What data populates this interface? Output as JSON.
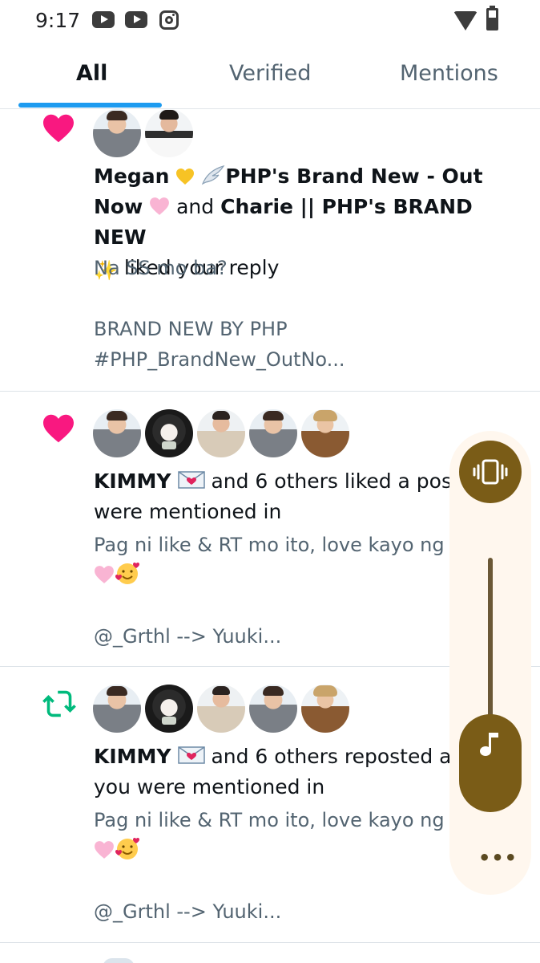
{
  "status_bar": {
    "time": "9:17",
    "notification_icons": [
      "youtube-icon",
      "youtube-icon",
      "instagram-icon"
    ],
    "system_icons": [
      "wifi-icon",
      "battery-icon"
    ]
  },
  "tabs": [
    {
      "label": "All",
      "active": true
    },
    {
      "label": "Verified",
      "active": false
    },
    {
      "label": "Mentions",
      "active": false
    }
  ],
  "colors": {
    "accent": "#1d9bf0",
    "like": "#f91880",
    "repost": "#00ba7c",
    "volume_panel": "#7a5c17"
  },
  "notifications": [
    {
      "type": "like",
      "icon": "heart-icon",
      "avatars": 2,
      "actor1_name": "Megan",
      "actor1_suffix": "PHP's Brand New - Out",
      "actor1_suffix2": "Now",
      "connector": "and",
      "actor2_name": "Charie || PHP's BRAND NEW",
      "action": "liked your reply",
      "quote_lines": [
        "Na SS mo ba?",
        "",
        "BRAND NEW BY PHP",
        "#PHP_BrandNew_OutNo..."
      ]
    },
    {
      "type": "like",
      "icon": "heart-icon",
      "avatars": 5,
      "actor_name": "KIMMY",
      "action_line1": "and 6 others liked a post you",
      "action_line2": "were mentioned in",
      "quote_line1": "Pag ni like & RT mo ito, love kayo ng PHP",
      "quote_line3": "@_Grthl  --> Yuuki..."
    },
    {
      "type": "repost",
      "icon": "repost-icon",
      "avatars": 5,
      "actor_name": "KIMMY",
      "action_line1": "and 6 others reposted a post",
      "action_line2": "you were mentioned in",
      "quote_line1": "Pag ni like & RT mo ito, love kayo ng PHP",
      "quote_line3": "@_Grthl  --> Yuuki..."
    }
  ],
  "volume_panel": {
    "mode_icon": "vibrate-icon",
    "stream_icon": "music-note-icon",
    "level": 0.15,
    "more_icon": "more-dots-icon"
  }
}
